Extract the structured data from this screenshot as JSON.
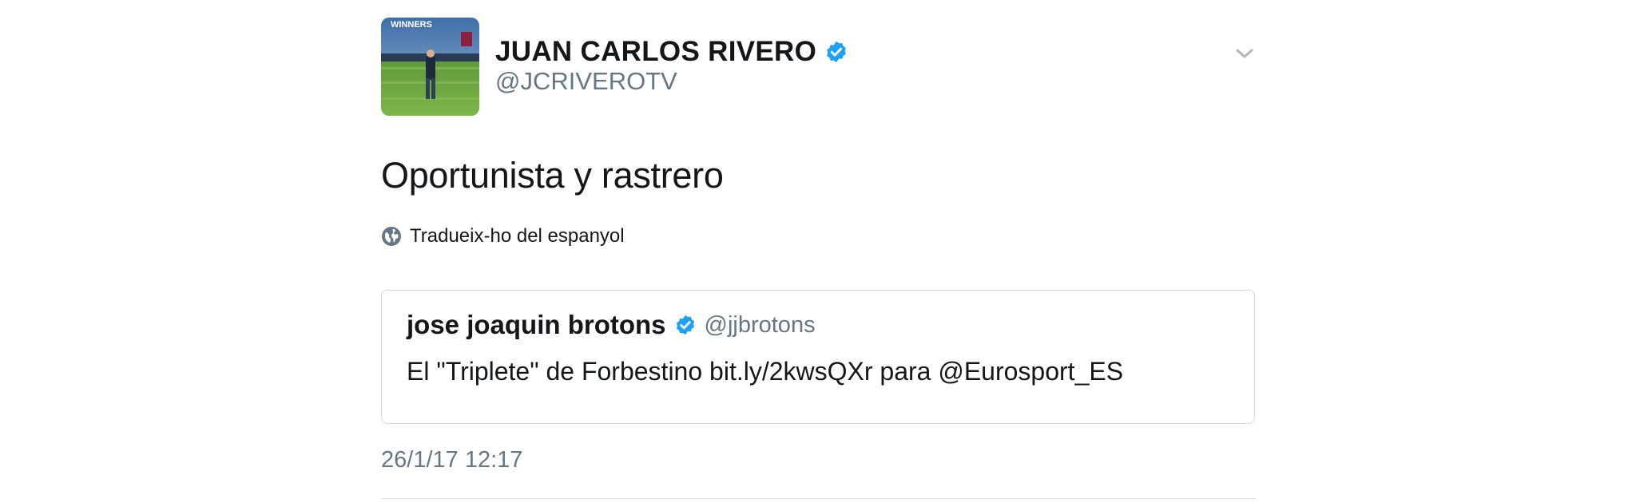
{
  "tweet": {
    "author": {
      "display_name": "JUAN CARLOS RIVERO",
      "handle": "@JCRIVEROTV",
      "verified": true,
      "avatar_banner_text": "WINNERS"
    },
    "text": "Oportunista y rastrero",
    "translate_label": "Tradueix-ho del espanyol",
    "timestamp": "26/1/17 12:17",
    "menu_icon": "chevron-down-icon",
    "quoted": {
      "display_name": "jose joaquin brotons",
      "handle": "@jjbrotons",
      "verified": true,
      "text": "El \"Triplete\" de Forbestino bit.ly/2kwsQXr para @Eurosport_ES"
    }
  },
  "colors": {
    "text_primary": "#14171a",
    "text_secondary": "#657786",
    "verified_blue": "#1da1f2",
    "border": "#d0d7de"
  }
}
